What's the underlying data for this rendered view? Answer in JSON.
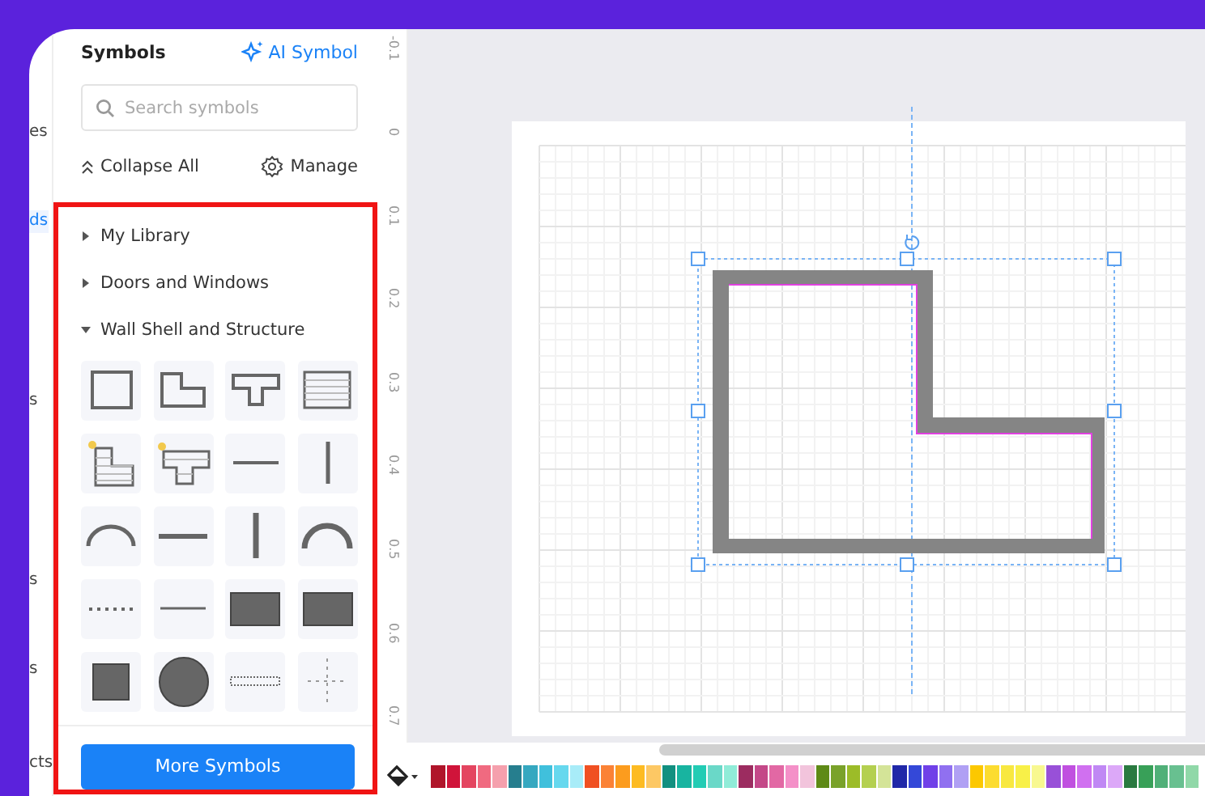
{
  "nav_items": [
    {
      "label": "es",
      "selected": false
    },
    {
      "label": "ds",
      "selected": true
    },
    {
      "label": "s",
      "selected": false
    },
    {
      "label": "s",
      "selected": false
    },
    {
      "label": "s",
      "selected": false
    },
    {
      "label": "cts",
      "selected": false
    }
  ],
  "panel": {
    "title": "Symbols",
    "ai_link": "AI Symbol",
    "search": {
      "placeholder": "Search symbols"
    },
    "collapse_all": "Collapse All",
    "manage": "Manage",
    "categories": [
      {
        "label": "My Library",
        "expanded": false
      },
      {
        "label": "Doors and Windows",
        "expanded": false
      },
      {
        "label": "Wall Shell and Structure",
        "expanded": true
      }
    ],
    "more_button": "More Symbols"
  },
  "ruler_labels": [
    "-0.1",
    "0",
    "0.1",
    "0.2",
    "0.3",
    "0.4",
    "0.5",
    "0.6",
    "0.7"
  ],
  "palette": [
    {
      "color": "#b0152a"
    },
    {
      "color": "#d0143a"
    },
    {
      "color": "#e44560"
    },
    {
      "color": "#f06a80"
    },
    {
      "color": "#f5a0ad"
    },
    {
      "color": "#267e8e"
    },
    {
      "color": "#35a8c0"
    },
    {
      "color": "#40c0dc"
    },
    {
      "color": "#66d8ee"
    },
    {
      "color": "#a8ecf8"
    },
    {
      "color": "#f05022"
    },
    {
      "color": "#fb8236"
    },
    {
      "color": "#fc9c1e"
    },
    {
      "color": "#fdbb22"
    },
    {
      "color": "#fdc864"
    },
    {
      "color": "#129080"
    },
    {
      "color": "#18b4a0"
    },
    {
      "color": "#22ccb4"
    },
    {
      "color": "#6ad8c8"
    },
    {
      "color": "#90ecd8"
    },
    {
      "color": "#9c2c60"
    },
    {
      "color": "#c44888"
    },
    {
      "color": "#e268a4"
    },
    {
      "color": "#f490c8"
    },
    {
      "color": "#f2c4dc"
    },
    {
      "color": "#5e8a16"
    },
    {
      "color": "#7aa22a"
    },
    {
      "color": "#9cbc28"
    },
    {
      "color": "#b4d050"
    },
    {
      "color": "#d4e498"
    },
    {
      "color": "#2028a8"
    },
    {
      "color": "#3448d8"
    },
    {
      "color": "#7040e8"
    },
    {
      "color": "#9070f0"
    },
    {
      "color": "#b0a0f4"
    },
    {
      "color": "#fcc800"
    },
    {
      "color": "#fcdc30"
    },
    {
      "color": "#f8e840"
    },
    {
      "color": "#f8f048"
    },
    {
      "color": "#f8f890"
    },
    {
      "color": "#9850d8"
    },
    {
      "color": "#c050e0"
    },
    {
      "color": "#d070f0"
    },
    {
      "color": "#c088f4"
    },
    {
      "color": "#dca8f8"
    },
    {
      "color": "#2a7a40"
    },
    {
      "color": "#38a058"
    },
    {
      "color": "#50b078"
    },
    {
      "color": "#68c090"
    },
    {
      "color": "#90d8a8"
    }
  ]
}
